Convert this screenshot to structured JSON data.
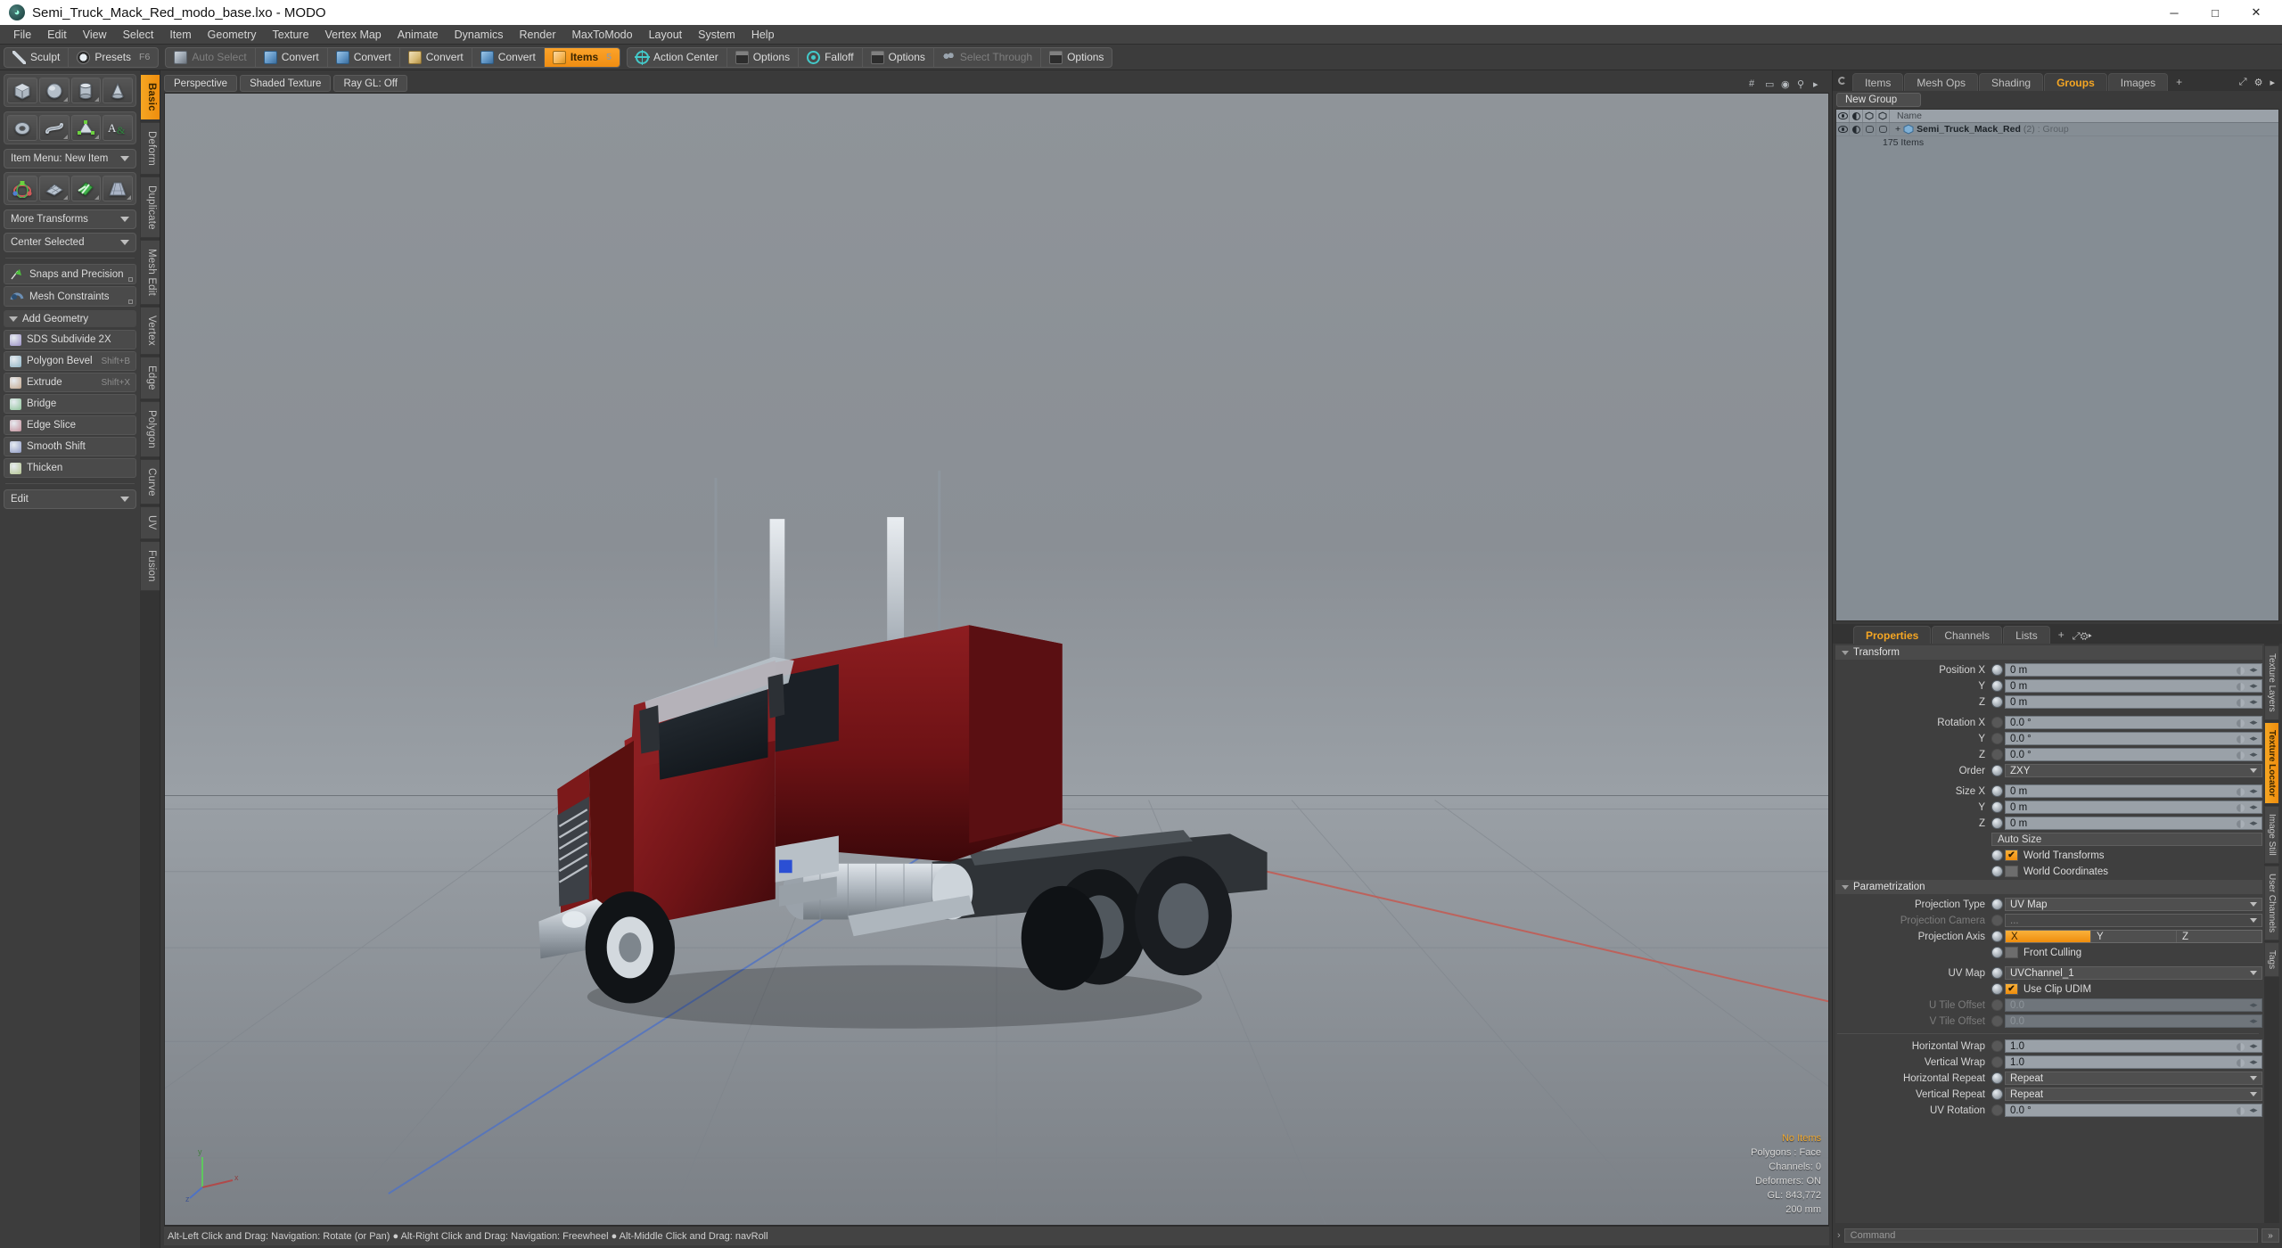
{
  "window": {
    "title": "Semi_Truck_Mack_Red_modo_base.lxo - MODO",
    "minimize": "─",
    "maximize": "□",
    "close": "✕"
  },
  "menubar": {
    "items": [
      "File",
      "Edit",
      "View",
      "Select",
      "Item",
      "Geometry",
      "Texture",
      "Vertex Map",
      "Animate",
      "Dynamics",
      "Render",
      "MaxToModo",
      "Layout",
      "System",
      "Help"
    ]
  },
  "toolbar": {
    "groups": [
      {
        "buttons": [
          {
            "label": "Sculpt",
            "icon": "pen-icon",
            "state": "normal",
            "shortcut": ""
          },
          {
            "label": "Presets",
            "icon": "presets-icon",
            "state": "normal",
            "shortcut": "F6"
          }
        ]
      },
      {
        "buttons": [
          {
            "label": "Auto Select",
            "icon": "cube-gray-icon",
            "state": "dim",
            "shortcut": ""
          },
          {
            "label": "Convert",
            "icon": "cube-blue-icon",
            "state": "normal",
            "shortcut": ""
          },
          {
            "label": "Convert",
            "icon": "cube-blue-icon",
            "state": "normal",
            "shortcut": ""
          },
          {
            "label": "Convert",
            "icon": "cube-yellow-icon",
            "state": "normal",
            "shortcut": ""
          },
          {
            "label": "Convert",
            "icon": "cube-blue-icon",
            "state": "normal",
            "shortcut": ""
          },
          {
            "label": "Items",
            "icon": "cube-orange-icon",
            "state": "active",
            "shortcut": "5"
          }
        ]
      },
      {
        "buttons": [
          {
            "label": "Action Center",
            "icon": "crosshair-icon",
            "state": "normal",
            "shortcut": ""
          },
          {
            "label": "Options",
            "icon": "options-icon",
            "state": "normal",
            "shortcut": ""
          },
          {
            "label": "Falloff",
            "icon": "falloff-icon",
            "state": "normal",
            "shortcut": ""
          },
          {
            "label": "Options",
            "icon": "options-icon",
            "state": "normal",
            "shortcut": ""
          },
          {
            "label": "Select Through",
            "icon": "select-through-icon",
            "state": "dim",
            "shortcut": ""
          },
          {
            "label": "Options",
            "icon": "options-icon",
            "state": "normal",
            "shortcut": ""
          }
        ]
      }
    ]
  },
  "left_panel": {
    "vertical_tabs": [
      {
        "label": "Basic",
        "active": true
      },
      {
        "label": "Deform",
        "active": false
      },
      {
        "label": "Duplicate",
        "active": false
      },
      {
        "label": "Mesh Edit",
        "active": false
      },
      {
        "label": "Vertex",
        "active": false
      },
      {
        "label": "Edge",
        "active": false
      },
      {
        "label": "Polygon",
        "active": false
      },
      {
        "label": "Curve",
        "active": false
      },
      {
        "label": "UV",
        "active": false
      },
      {
        "label": "Fusion",
        "active": false
      }
    ],
    "primitives_row1": [
      "cube-tool",
      "sphere-tool",
      "cylinder-tool",
      "cone-tool"
    ],
    "primitives_row2": [
      "torus-tool",
      "helix-tool",
      "prism-tool",
      "text-tool"
    ],
    "item_menu": "Item Menu: New Item",
    "transforms_row": [
      "transform-tool",
      "mesh-paint-tool",
      "uv-tool",
      "perspective-tool"
    ],
    "more_transforms": "More Transforms",
    "center_selected": "Center Selected",
    "snaps": "Snaps and Precision",
    "mesh_constraints": "Mesh Constraints",
    "add_geometry": "Add Geometry",
    "tools": [
      {
        "label": "SDS Subdivide 2X",
        "shortcut": ""
      },
      {
        "label": "Polygon Bevel",
        "shortcut": "Shift+B"
      },
      {
        "label": "Extrude",
        "shortcut": "Shift+X"
      },
      {
        "label": "Bridge",
        "shortcut": ""
      },
      {
        "label": "Edge Slice",
        "shortcut": ""
      },
      {
        "label": "Smooth Shift",
        "shortcut": ""
      },
      {
        "label": "Thicken",
        "shortcut": ""
      }
    ],
    "edit_dropdown": "Edit"
  },
  "viewport": {
    "tabs": [
      {
        "label": "Perspective"
      },
      {
        "label": "Shaded Texture"
      },
      {
        "label": "Ray GL: Off"
      }
    ],
    "stats": {
      "items": "No Items",
      "polygons": "Polygons : Face",
      "channels": "Channels: 0",
      "deformers": "Deformers: ON",
      "gl": "GL: 843,772",
      "scale": "200 mm"
    },
    "axes": {
      "x": "x",
      "y": "y",
      "z": "z"
    }
  },
  "statusbar": {
    "text": "Alt-Left Click and Drag: Navigation: Rotate (or Pan) ●  Alt-Right Click and Drag: Navigation: Freewheel ●  Alt-Middle Click and Drag: navRoll"
  },
  "right_panel": {
    "tabs": [
      {
        "label": "Items",
        "active": false
      },
      {
        "label": "Mesh Ops",
        "active": false
      },
      {
        "label": "Shading",
        "active": false
      },
      {
        "label": "Groups",
        "active": true
      },
      {
        "label": "Images",
        "active": false
      },
      {
        "label": "+",
        "active": false
      }
    ],
    "new_group_button": "New Group",
    "tree": {
      "columns": [
        "visibility-column",
        "shading-column",
        "render-column",
        "lock-column",
        "Name"
      ],
      "name_header": "Name",
      "rows": [
        {
          "expander": "+",
          "name": "Semi_Truck_Mack_Red",
          "count": "(2)",
          "type": ": Group",
          "sub": "175 Items"
        }
      ]
    },
    "properties": {
      "tabs": [
        {
          "label": "Properties",
          "active": true
        },
        {
          "label": "Channels",
          "active": false
        },
        {
          "label": "Lists",
          "active": false
        },
        {
          "label": "+",
          "active": false
        }
      ],
      "vertical_tabs": [
        {
          "label": "Texture Layers",
          "active": false
        },
        {
          "label": "Texture Locator",
          "active": true
        },
        {
          "label": "Image Still",
          "active": false
        },
        {
          "label": "User Channels",
          "active": false
        },
        {
          "label": "Tags",
          "active": false
        }
      ],
      "sections": [
        {
          "title": "Transform",
          "rows": [
            {
              "type": "field",
              "label": "Position X",
              "value": "0 m",
              "disabled": false
            },
            {
              "type": "field",
              "label": "Y",
              "value": "0 m",
              "disabled": false
            },
            {
              "type": "field",
              "label": "Z",
              "value": "0 m",
              "disabled": false
            },
            {
              "type": "gap"
            },
            {
              "type": "field",
              "label": "Rotation X",
              "value": "0.0 °",
              "disabled": false,
              "knob_dim": true
            },
            {
              "type": "field",
              "label": "Y",
              "value": "0.0 °",
              "disabled": false,
              "knob_dim": true
            },
            {
              "type": "field",
              "label": "Z",
              "value": "0.0 °",
              "disabled": false,
              "knob_dim": true
            },
            {
              "type": "select",
              "label": "Order",
              "value": "ZXY",
              "disabled": false
            },
            {
              "type": "gap"
            },
            {
              "type": "field",
              "label": "Size X",
              "value": "0 m",
              "disabled": false
            },
            {
              "type": "field",
              "label": "Y",
              "value": "0 m",
              "disabled": false
            },
            {
              "type": "field",
              "label": "Z",
              "value": "0 m",
              "disabled": false
            },
            {
              "type": "button",
              "label": "",
              "value": "Auto Size"
            },
            {
              "type": "checkbox",
              "label": "World Transforms",
              "checked": true
            },
            {
              "type": "checkbox",
              "label": "World Coordinates",
              "checked": false
            }
          ]
        },
        {
          "title": "Parametrization",
          "rows": [
            {
              "type": "select",
              "label": "Projection Type",
              "value": "UV Map",
              "disabled": false
            },
            {
              "type": "select",
              "label": "Projection Camera",
              "value": "...",
              "disabled": true
            },
            {
              "type": "axis3",
              "label": "Projection Axis",
              "options": [
                "X",
                "Y",
                "Z"
              ],
              "selected": "X"
            },
            {
              "type": "checkbox",
              "label": "Front Culling",
              "checked": false
            },
            {
              "type": "gap"
            },
            {
              "type": "select",
              "label": "UV Map",
              "value": "UVChannel_1",
              "disabled": false
            },
            {
              "type": "checkbox",
              "label": "Use Clip UDIM",
              "checked": true
            },
            {
              "type": "field",
              "label": "U Tile Offset",
              "value": "0.0",
              "disabled": true
            },
            {
              "type": "field",
              "label": "V Tile Offset",
              "value": "0.0",
              "disabled": true
            },
            {
              "type": "hr"
            },
            {
              "type": "field",
              "label": "Horizontal Wrap",
              "value": "1.0",
              "disabled": false,
              "knob_dim": true
            },
            {
              "type": "field",
              "label": "Vertical Wrap",
              "value": "1.0",
              "disabled": false,
              "knob_dim": true
            },
            {
              "type": "select",
              "label": "Horizontal Repeat",
              "value": "Repeat",
              "disabled": false
            },
            {
              "type": "select",
              "label": "Vertical Repeat",
              "value": "Repeat",
              "disabled": false
            },
            {
              "type": "field",
              "label": "UV Rotation",
              "value": "0.0 °",
              "disabled": false,
              "knob_dim": true
            }
          ]
        }
      ]
    },
    "command_bar": {
      "prompt": "›",
      "placeholder": "Command",
      "go": "»"
    }
  },
  "colors": {
    "accent": "#f5a623",
    "panel": "#3a3a3a",
    "field": "#9aa1a8",
    "truck_body": "#6e1417",
    "viewport_sky": "#8f9499"
  }
}
